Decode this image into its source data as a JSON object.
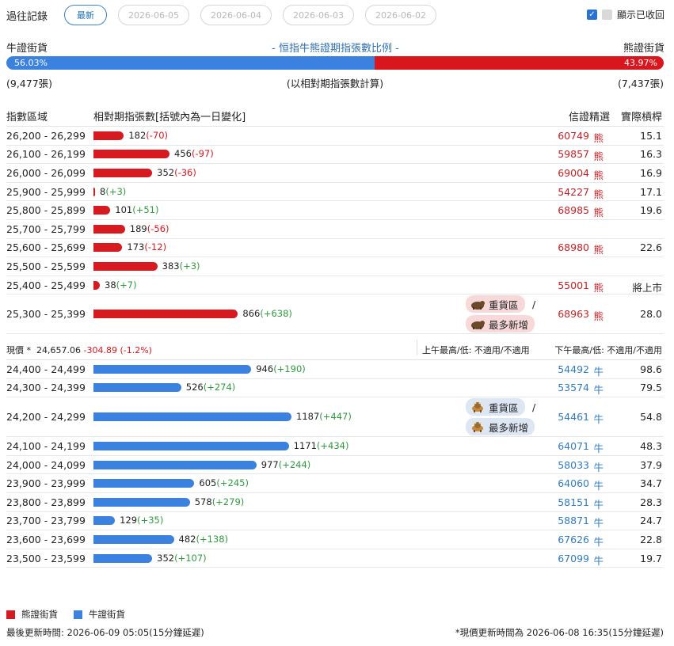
{
  "history": {
    "label": "過往記錄",
    "tabs": [
      "最新",
      "2026-06-05",
      "2026-06-04",
      "2026-06-03",
      "2026-06-02"
    ]
  },
  "show_recalled": {
    "label": "顯示已收回",
    "checked": true
  },
  "ratio": {
    "left_label": "牛證街貨",
    "right_label": "熊證街貨",
    "title": "- 恒指牛熊證期指張數比例 -",
    "bull_pct": "56.03%",
    "bear_pct": "43.97%",
    "bull_fraction": 0.5603,
    "bull_count": "(9,477張)",
    "bear_count": "(7,437張)",
    "note": "(以相對期指張數計算)"
  },
  "columns": {
    "range": "指數區域",
    "count": "相對期指張數[括號內為一日變化]",
    "code": "信證精選",
    "leverage": "實際槓桿"
  },
  "bar_max": 1187,
  "bear_rows": [
    {
      "range": "26,200 - 26,299",
      "count": 182,
      "count_text": "182",
      "change": "(-70)",
      "code": "60749",
      "tag": "熊",
      "lev": "15.1"
    },
    {
      "range": "26,100 - 26,199",
      "count": 456,
      "count_text": "456",
      "change": "(-97)",
      "code": "59857",
      "tag": "熊",
      "lev": "16.3"
    },
    {
      "range": "26,000 - 26,099",
      "count": 352,
      "count_text": "352",
      "change": "(-36)",
      "code": "69004",
      "tag": "熊",
      "lev": "16.9"
    },
    {
      "range": "25,900 - 25,999",
      "count": 8,
      "count_text": "8",
      "change": "(+3)",
      "code": "54227",
      "tag": "熊",
      "lev": "17.1"
    },
    {
      "range": "25,800 - 25,899",
      "count": 101,
      "count_text": "101",
      "change": "(+51)",
      "code": "68985",
      "tag": "熊",
      "lev": "19.6"
    },
    {
      "range": "25,700 - 25,799",
      "count": 189,
      "count_text": "189",
      "change": "(-56)",
      "code": "",
      "tag": "",
      "lev": ""
    },
    {
      "range": "25,600 - 25,699",
      "count": 173,
      "count_text": "173",
      "change": "(-12)",
      "code": "68980",
      "tag": "熊",
      "lev": "22.6"
    },
    {
      "range": "25,500 - 25,599",
      "count": 383,
      "count_text": "383",
      "change": "(+3)",
      "code": "",
      "tag": "",
      "lev": ""
    },
    {
      "range": "25,400 - 25,499",
      "count": 38,
      "count_text": "38",
      "change": "(+7)",
      "code": "55001",
      "tag": "熊",
      "lev": "將上市"
    },
    {
      "range": "25,300 - 25,399",
      "count": 866,
      "count_text": "866",
      "change": "(+638)",
      "code": "68963",
      "tag": "熊",
      "lev": "28.0",
      "badges": [
        "重貨區",
        "最多新增"
      ]
    }
  ],
  "spot": {
    "label": "現價 *",
    "price": "24,657.06",
    "change": "-304.89 (-1.2%)",
    "am": "上午最高/低: 不適用/不適用",
    "pm": "下午最高/低: 不適用/不適用"
  },
  "bull_rows": [
    {
      "range": "24,400 - 24,499",
      "count": 946,
      "count_text": "946",
      "change": "(+190)",
      "code": "54492",
      "tag": "牛",
      "lev": "98.6"
    },
    {
      "range": "24,300 - 24,399",
      "count": 526,
      "count_text": "526",
      "change": "(+274)",
      "code": "53574",
      "tag": "牛",
      "lev": "79.5"
    },
    {
      "range": "24,200 - 24,299",
      "count": 1187,
      "count_text": "1187",
      "change": "(+447)",
      "code": "54461",
      "tag": "牛",
      "lev": "54.8",
      "badges": [
        "重貨區",
        "最多新增"
      ]
    },
    {
      "range": "24,100 - 24,199",
      "count": 1171,
      "count_text": "1171",
      "change": "(+434)",
      "code": "64071",
      "tag": "牛",
      "lev": "48.3"
    },
    {
      "range": "24,000 - 24,099",
      "count": 977,
      "count_text": "977",
      "change": "(+244)",
      "code": "58033",
      "tag": "牛",
      "lev": "37.9"
    },
    {
      "range": "23,900 - 23,999",
      "count": 605,
      "count_text": "605",
      "change": "(+245)",
      "code": "64060",
      "tag": "牛",
      "lev": "34.7"
    },
    {
      "range": "23,800 - 23,899",
      "count": 578,
      "count_text": "578",
      "change": "(+279)",
      "code": "58151",
      "tag": "牛",
      "lev": "28.3"
    },
    {
      "range": "23,700 - 23,799",
      "count": 129,
      "count_text": "129",
      "change": "(+35)",
      "code": "58871",
      "tag": "牛",
      "lev": "24.7"
    },
    {
      "range": "23,600 - 23,699",
      "count": 482,
      "count_text": "482",
      "change": "(+138)",
      "code": "67626",
      "tag": "牛",
      "lev": "22.8"
    },
    {
      "range": "23,500 - 23,599",
      "count": 352,
      "count_text": "352",
      "change": "(+107)",
      "code": "67099",
      "tag": "牛",
      "lev": "19.7"
    }
  ],
  "legend": {
    "bear": "熊證街貨",
    "bull": "牛證街貨"
  },
  "footer": {
    "updated": "最後更新時間: 2026-06-09 05:05(15分鐘延遲)",
    "spot_updated": "*現價更新時間為 2026-06-08 16:35(15分鐘延遲)"
  },
  "colors": {
    "bear": "#d71920",
    "bull": "#3b82e0",
    "positive": "#2e9b3e",
    "negative": "#d9161e"
  },
  "icons": {
    "bear_badge": "bear-icon",
    "bull_badge": "bull-icon",
    "checkbox": "checkbox-icon"
  }
}
